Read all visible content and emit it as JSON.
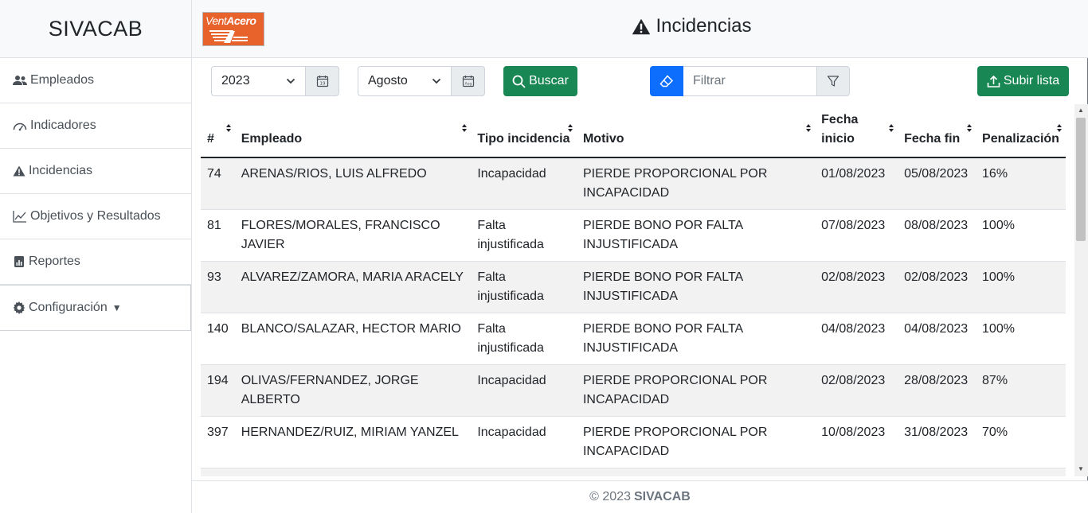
{
  "app": {
    "brand": "SIVACAB"
  },
  "logo": {
    "text_light": "Vent",
    "text_bold": "Acero",
    "color": "#e8622b"
  },
  "sidebar": {
    "items": [
      {
        "label": "Empleados",
        "icon": "users-icon"
      },
      {
        "label": "Indicadores",
        "icon": "gauge-icon"
      },
      {
        "label": "Incidencias",
        "icon": "warning-icon"
      },
      {
        "label": "Objetivos y Resultados",
        "icon": "chart-line-icon"
      },
      {
        "label": "Reportes",
        "icon": "report-icon"
      },
      {
        "label": "Configuración",
        "icon": "gear-icon"
      }
    ]
  },
  "header": {
    "title": "Incidencias"
  },
  "toolbar": {
    "year": "2023",
    "month": "Agosto",
    "search_label": "Buscar",
    "filter_placeholder": "Filtrar",
    "upload_label": "Subir lista"
  },
  "table": {
    "columns": [
      "#",
      "Empleado",
      "Tipo incidencia",
      "Motivo",
      "Fecha inicio",
      "Fecha fin",
      "Penalización"
    ],
    "rows": [
      {
        "num": "74",
        "empleado": "ARENAS/RIOS, LUIS ALFREDO",
        "tipo": "Incapacidad",
        "motivo": "PIERDE PROPORCIONAL POR INCAPACIDAD",
        "inicio": "01/08/2023",
        "fin": "05/08/2023",
        "pen": "16%"
      },
      {
        "num": "81",
        "empleado": "FLORES/MORALES, FRANCISCO JAVIER",
        "tipo": "Falta injustificada",
        "motivo": "PIERDE BONO POR FALTA INJUSTIFICADA",
        "inicio": "07/08/2023",
        "fin": "08/08/2023",
        "pen": "100%"
      },
      {
        "num": "93",
        "empleado": "ALVAREZ/ZAMORA, MARIA ARACELY",
        "tipo": "Falta injustificada",
        "motivo": "PIERDE BONO POR FALTA INJUSTIFICADA",
        "inicio": "02/08/2023",
        "fin": "02/08/2023",
        "pen": "100%"
      },
      {
        "num": "140",
        "empleado": "BLANCO/SALAZAR, HECTOR MARIO",
        "tipo": "Falta injustificada",
        "motivo": "PIERDE BONO POR FALTA INJUSTIFICADA",
        "inicio": "04/08/2023",
        "fin": "04/08/2023",
        "pen": "100%"
      },
      {
        "num": "194",
        "empleado": "OLIVAS/FERNANDEZ, JORGE ALBERTO",
        "tipo": "Incapacidad",
        "motivo": "PIERDE PROPORCIONAL POR INCAPACIDAD",
        "inicio": "02/08/2023",
        "fin": "28/08/2023",
        "pen": "87%"
      },
      {
        "num": "397",
        "empleado": "HERNANDEZ/RUIZ, MIRIAM YANZEL",
        "tipo": "Incapacidad",
        "motivo": "PIERDE PROPORCIONAL POR INCAPACIDAD",
        "inicio": "10/08/2023",
        "fin": "31/08/2023",
        "pen": "70%"
      }
    ]
  },
  "footer": {
    "copyright": "© 2023",
    "brand": "SIVACAB"
  },
  "colors": {
    "success": "#198754",
    "primary": "#0d6efd",
    "stripe": "#f2f2f2"
  }
}
